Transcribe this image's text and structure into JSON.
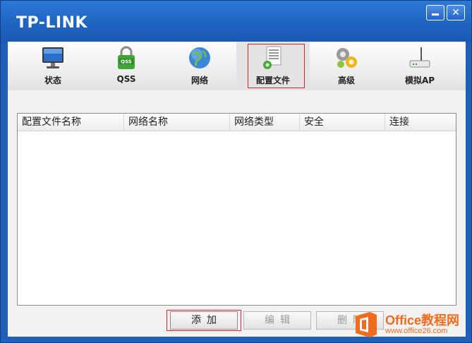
{
  "app": {
    "logo": "TP-LINK"
  },
  "window_controls": {
    "minimize": "minimize",
    "close": "✕"
  },
  "tabs": [
    {
      "label": "状态",
      "icon": "monitor-icon"
    },
    {
      "label": "QSS",
      "icon": "qss-lock-icon",
      "badge": "QSS"
    },
    {
      "label": "网络",
      "icon": "globe-icon"
    },
    {
      "label": "配置文件",
      "icon": "profile-document-icon",
      "selected": true
    },
    {
      "label": "高级",
      "icon": "gears-icon"
    },
    {
      "label": "模拟AP",
      "icon": "router-icon"
    }
  ],
  "profile_table": {
    "columns": [
      "配置文件名称",
      "网络名称",
      "网络类型",
      "安全",
      "连接"
    ],
    "rows": []
  },
  "buttons": {
    "add": "添加",
    "edit": "编辑",
    "delete": "删除"
  },
  "watermark": {
    "brand": "Office教程网",
    "url": "www.office26.com"
  },
  "colors": {
    "titlebar": "#1e64c2",
    "highlight_box": "#d9222a",
    "watermark": "#f26b1d"
  }
}
